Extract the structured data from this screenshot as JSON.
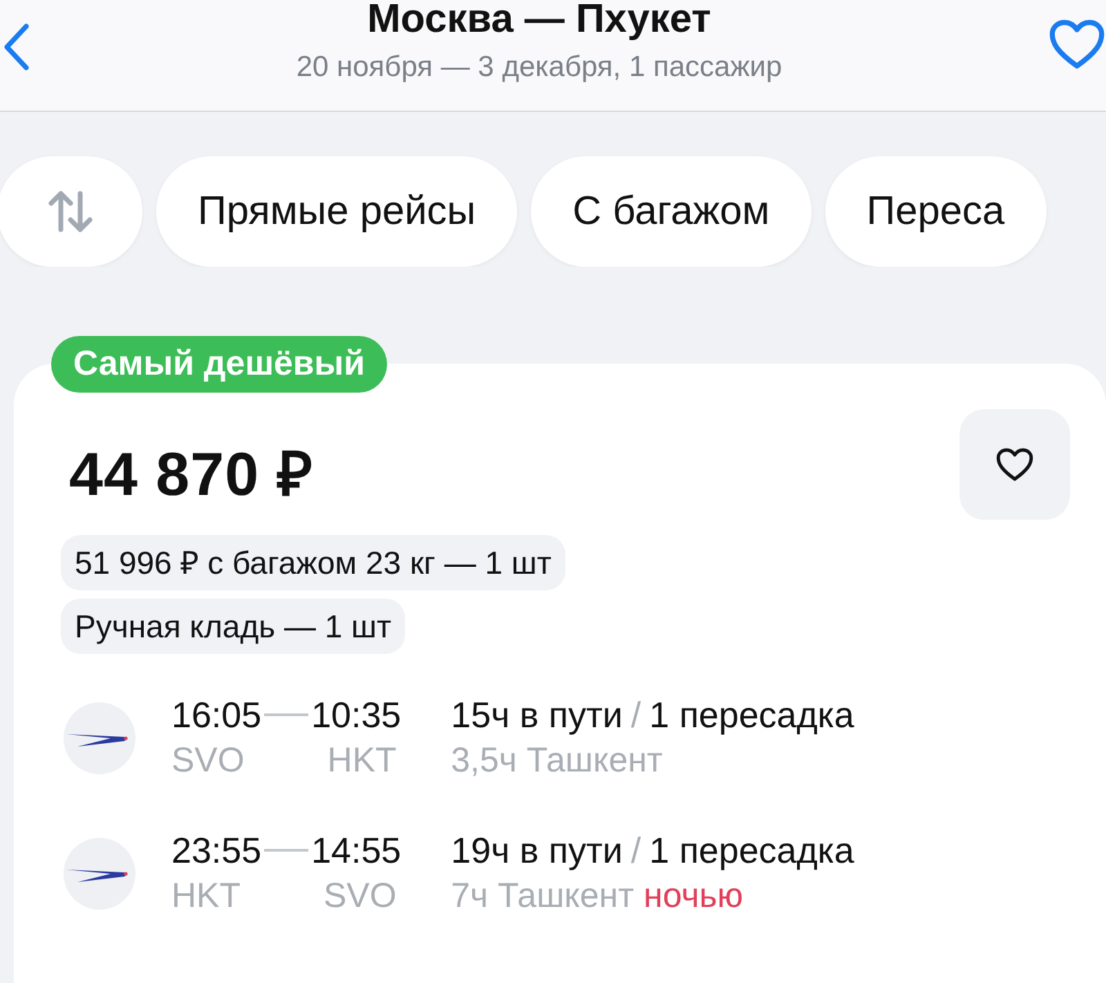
{
  "header": {
    "title": "Москва — Пхукет",
    "subtitle": "20 ноября — 3 декабря, 1 пассажир",
    "favorite": false
  },
  "filters": [
    {
      "kind": "sort"
    },
    {
      "kind": "label",
      "label": "Прямые рейсы"
    },
    {
      "kind": "label",
      "label": "С багажом"
    },
    {
      "kind": "label",
      "label": "Переса"
    }
  ],
  "offer": {
    "badge": "Самый дешёвый",
    "price": "44 870 ₽",
    "favorite": false,
    "tags": [
      "51 996 ₽ с багажом 23 кг — 1 шт",
      "Ручная кладь — 1 шт"
    ],
    "segments": [
      {
        "departure": "16:05",
        "arrival": "10:35",
        "from": "SVO",
        "to": "HKT",
        "duration": "15ч в пути",
        "separator": "/",
        "transfers": "1 пересадка",
        "layover": "3,5ч Ташкент"
      },
      {
        "departure": "23:55",
        "arrival": "14:55",
        "from": "HKT",
        "to": "SVO",
        "duration": "19ч в пути",
        "separator": "/",
        "transfers": "1 пересадка",
        "layover": "7ч Ташкент",
        "layover_note": "ночью"
      }
    ]
  }
}
